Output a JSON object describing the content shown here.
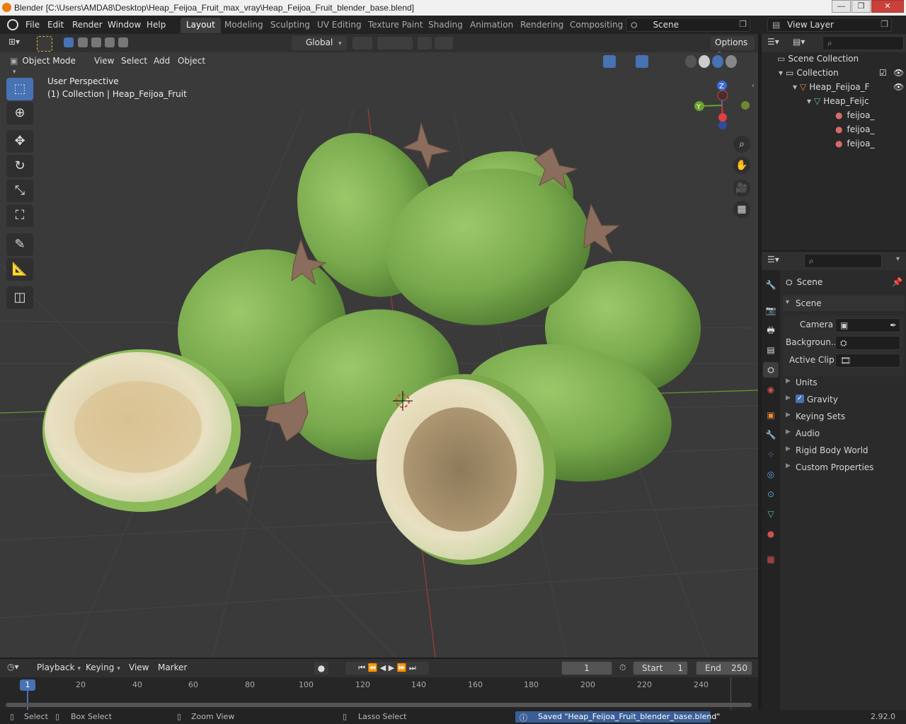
{
  "window": {
    "title": "Blender [C:\\Users\\AMDA8\\Desktop\\Heap_Feijoa_Fruit_max_vray\\Heap_Feijoa_Fruit_blender_base.blend]",
    "minimize": "—",
    "maximize": "❐",
    "close": "✕"
  },
  "menubar": {
    "items": [
      "File",
      "Edit",
      "Render",
      "Window",
      "Help"
    ],
    "workspaces": [
      "Layout",
      "Modeling",
      "Sculpting",
      "UV Editing",
      "Texture Paint",
      "Shading",
      "Animation",
      "Rendering",
      "Compositing"
    ],
    "active_workspace": "Layout",
    "scene_name": "Scene",
    "view_layer": "View Layer"
  },
  "tool_header": {
    "transform_orientation": "Global",
    "options": "Options"
  },
  "viewport_header": {
    "mode": "Object Mode",
    "menus": [
      "View",
      "Select",
      "Add",
      "Object"
    ]
  },
  "viewport": {
    "perspective": "User Perspective",
    "collection_info": "(1) Collection | Heap_Feijoa_Fruit",
    "gizmo": {
      "z": "Z",
      "y": "Y"
    }
  },
  "outliner": {
    "search_placeholder": "",
    "rows": [
      {
        "label": "Scene Collection"
      },
      {
        "label": "Collection"
      },
      {
        "label": "Heap_Feijoa_F"
      },
      {
        "label": "Heap_Feijc"
      },
      {
        "label": "feijoa_"
      },
      {
        "label": "feijoa_"
      },
      {
        "label": "feijoa_"
      }
    ]
  },
  "properties": {
    "search_placeholder": "",
    "context": "Scene",
    "panel_title": "Scene",
    "camera_label": "Camera",
    "background_label": "Backgroun...",
    "active_clip_label": "Active Clip",
    "sections": [
      "Units",
      "Gravity",
      "Keying Sets",
      "Audio",
      "Rigid Body World",
      "Custom Properties"
    ],
    "gravity_checked": true
  },
  "timeline": {
    "menus": [
      "Playback",
      "Keying",
      "View",
      "Marker"
    ],
    "current_frame": "1",
    "start_label": "Start",
    "start_value": "1",
    "end_label": "End",
    "end_value": "250",
    "ruler": [
      "1",
      "20",
      "40",
      "60",
      "80",
      "100",
      "120",
      "140",
      "160",
      "180",
      "200",
      "220",
      "240"
    ]
  },
  "statusbar": {
    "select": "Select",
    "box_select": "Box Select",
    "zoom_view": "Zoom View",
    "lasso_select": "Lasso Select",
    "message": "Saved \"Heap_Feijoa_Fruit_blender_base.blend\"",
    "version": "2.92.0"
  },
  "colors": {
    "accent": "#4772b3",
    "fruit_skin": "#7fae52",
    "fruit_flesh": "#e2d6b0",
    "viewport_bg": "#3a3a3a"
  }
}
